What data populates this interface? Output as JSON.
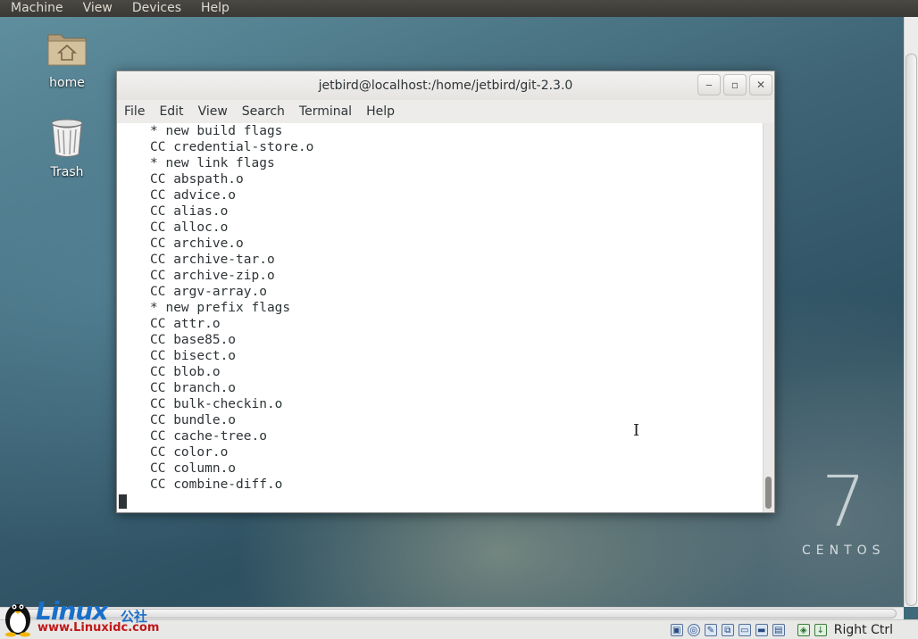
{
  "host_menu": [
    "Machine",
    "View",
    "Devices",
    "Help"
  ],
  "desktop": {
    "icons": [
      {
        "label": "home"
      },
      {
        "label": "Trash"
      }
    ],
    "branding_number": "7",
    "branding_word": "CENTOS"
  },
  "window": {
    "title": "jetbird@localhost:/home/jetbird/git-2.3.0",
    "buttons": {
      "minimize": "‒",
      "maximize": "▫",
      "close": "✕"
    },
    "menu": [
      "File",
      "Edit",
      "View",
      "Search",
      "Terminal",
      "Help"
    ]
  },
  "terminal": {
    "lines": [
      "    * new build flags",
      "    CC credential-store.o",
      "    * new link flags",
      "    CC abspath.o",
      "    CC advice.o",
      "    CC alias.o",
      "    CC alloc.o",
      "    CC archive.o",
      "    CC archive-tar.o",
      "    CC archive-zip.o",
      "    CC argv-array.o",
      "    * new prefix flags",
      "    CC attr.o",
      "    CC base85.o",
      "    CC bisect.o",
      "    CC blob.o",
      "    CC branch.o",
      "    CC bulk-checkin.o",
      "    CC bundle.o",
      "    CC cache-tree.o",
      "    CC color.o",
      "    CC column.o",
      "    CC combine-diff.o"
    ]
  },
  "statusbar": {
    "host_key": "Right Ctrl"
  },
  "watermark": {
    "brand": "Linux",
    "brand_cn": "公社",
    "url": "www.Linuxidc.com"
  },
  "colors": {
    "terminal_text": "#2e3436",
    "watermark_blue": "#1a6fc9",
    "watermark_red": "#c0181a"
  }
}
